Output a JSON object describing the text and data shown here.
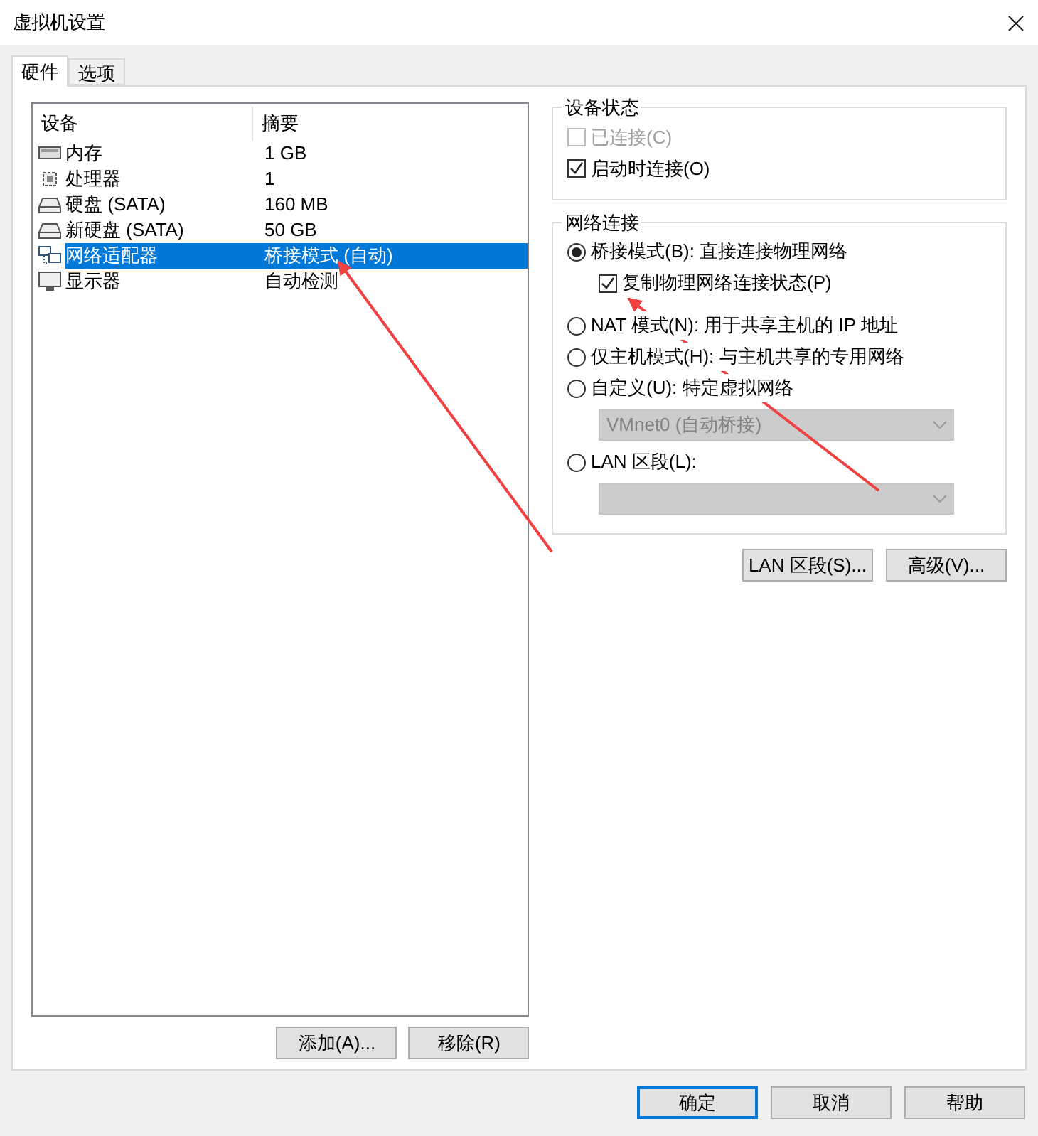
{
  "window": {
    "title": "虚拟机设置"
  },
  "tabs": [
    {
      "label": "硬件",
      "selected": true
    },
    {
      "label": "选项",
      "selected": false
    }
  ],
  "device_table": {
    "columns": [
      "设备",
      "摘要"
    ],
    "rows": [
      {
        "kind": "memory",
        "device": "内存",
        "summary": "1 GB",
        "selected": false
      },
      {
        "kind": "processor",
        "device": "处理器",
        "summary": "1",
        "selected": false
      },
      {
        "kind": "disk",
        "device": "硬盘 (SATA)",
        "summary": "160 MB",
        "selected": false
      },
      {
        "kind": "disk",
        "device": "新硬盘 (SATA)",
        "summary": "50 GB",
        "selected": false
      },
      {
        "kind": "network",
        "device": "网络适配器",
        "summary": "桥接模式 (自动)",
        "selected": true
      },
      {
        "kind": "display",
        "device": "显示器",
        "summary": "自动检测",
        "selected": false
      }
    ]
  },
  "device_buttons": [
    "添加(A)...",
    "移除(R)"
  ],
  "device_status": {
    "title": "设备状态",
    "options": [
      {
        "label": "已连接(C)",
        "checked": false,
        "disabled": true
      },
      {
        "label": "启动时连接(O)",
        "checked": true,
        "disabled": false
      }
    ]
  },
  "network_connection": {
    "title": "网络连接",
    "options": [
      {
        "kind": "radio",
        "label": "桥接模式(B): 直接连接物理网络",
        "selected": true
      },
      {
        "kind": "checkbox",
        "label": "复制物理网络连接状态(P)",
        "checked": true
      },
      {
        "kind": "radio",
        "label": "NAT 模式(N): 用于共享主机的 IP 地址",
        "selected": false
      },
      {
        "kind": "radio",
        "label": "仅主机模式(H): 与主机共享的专用网络",
        "selected": false
      },
      {
        "kind": "radio",
        "label": "自定义(U): 特定虚拟网络",
        "selected": false
      },
      {
        "kind": "dropdown",
        "value": "VMnet0 (自动桥接)",
        "disabled": true
      },
      {
        "kind": "radio",
        "label": "LAN 区段(L):",
        "selected": false
      },
      {
        "kind": "dropdown",
        "disabled": true
      }
    ]
  },
  "network_buttons": [
    "LAN 区段(S)...",
    "高级(V)..."
  ],
  "dialog_buttons": [
    {
      "label": "确定",
      "default": true
    },
    {
      "label": "取消",
      "default": false
    },
    {
      "label": "帮助",
      "default": false
    }
  ]
}
